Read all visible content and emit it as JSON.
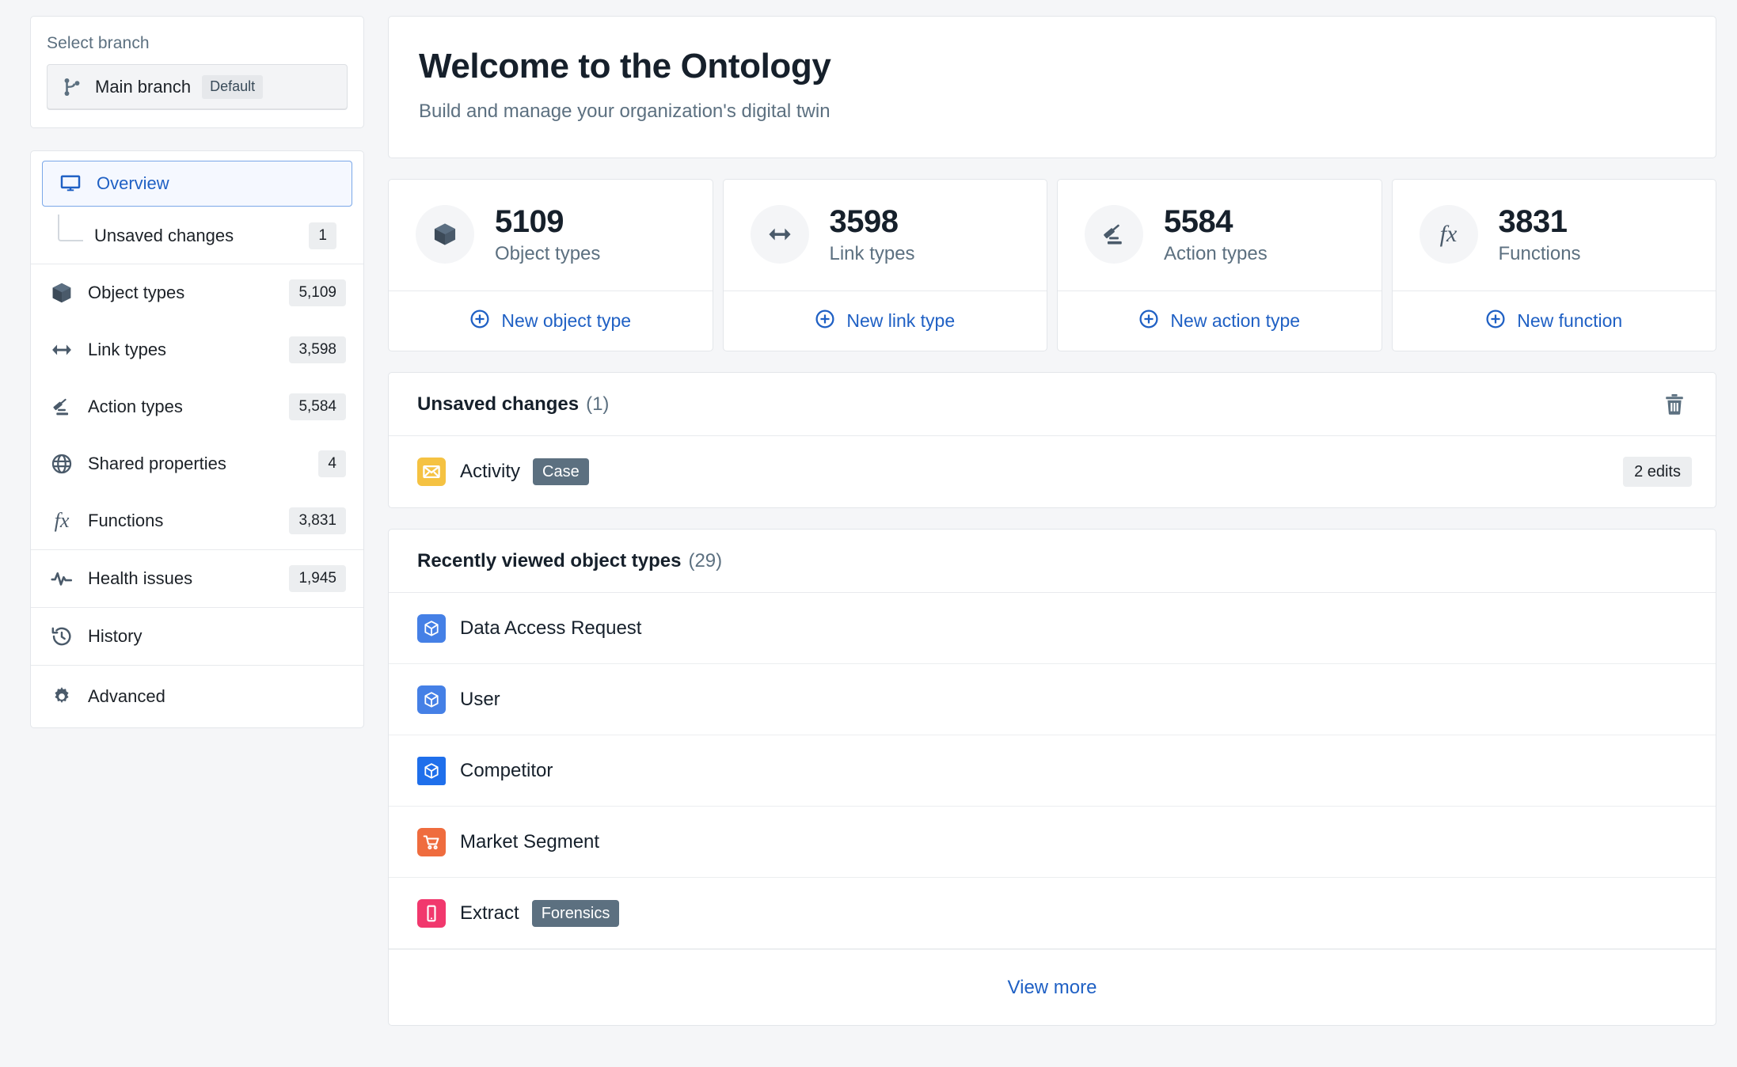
{
  "sidebar": {
    "branch": {
      "label": "Select branch",
      "name": "Main branch",
      "badge": "Default",
      "icon": "git-branch-icon"
    },
    "nav": {
      "overview": {
        "label": "Overview",
        "icon": "desktop-icon"
      },
      "unsaved": {
        "label": "Unsaved changes",
        "count": "1"
      },
      "items": [
        {
          "label": "Object types",
          "count": "5,109",
          "icon": "cube-icon"
        },
        {
          "label": "Link types",
          "count": "3,598",
          "icon": "arrows-horizontal-icon"
        },
        {
          "label": "Action types",
          "count": "5,584",
          "icon": "gavel-icon"
        },
        {
          "label": "Shared properties",
          "count": "4",
          "icon": "globe-icon"
        },
        {
          "label": "Functions",
          "count": "3,831",
          "icon": "fx-icon"
        },
        {
          "label": "Health issues",
          "count": "1,945",
          "icon": "pulse-icon"
        },
        {
          "label": "History",
          "count": "",
          "icon": "history-icon"
        },
        {
          "label": "Advanced",
          "count": "",
          "icon": "gear-icon"
        }
      ]
    }
  },
  "hero": {
    "title": "Welcome to the Ontology",
    "subtitle": "Build and manage your organization's digital twin"
  },
  "stats": [
    {
      "value": "5109",
      "label": "Object types",
      "action": "New object type",
      "icon": "cube-icon"
    },
    {
      "value": "3598",
      "label": "Link types",
      "action": "New link type",
      "icon": "arrows-horizontal-icon"
    },
    {
      "value": "5584",
      "label": "Action types",
      "action": "New action type",
      "icon": "gavel-icon"
    },
    {
      "value": "3831",
      "label": "Functions",
      "action": "New function",
      "icon": "fx-icon"
    }
  ],
  "unsaved_changes": {
    "title": "Unsaved changes",
    "count": "(1)",
    "delete_icon": "trash-icon",
    "rows": [
      {
        "label": "Activity",
        "tag": "Case",
        "edits": "2 edits",
        "icon": "envelope-icon",
        "icon_color": "#f5c242"
      }
    ]
  },
  "recently_viewed": {
    "title": "Recently viewed object types",
    "count": "(29)",
    "view_more": "View more",
    "rows": [
      {
        "label": "Data Access Request",
        "tag": "",
        "icon": "cube-icon",
        "icon_color": "#4580e6"
      },
      {
        "label": "User",
        "tag": "",
        "icon": "cube-icon",
        "icon_color": "#4580e6"
      },
      {
        "label": "Competitor",
        "tag": "",
        "icon": "cube-icon",
        "icon_color": "#1f6feb"
      },
      {
        "label": "Market Segment",
        "tag": "",
        "icon": "cart-icon",
        "icon_color": "#ef6c3e"
      },
      {
        "label": "Extract",
        "tag": "Forensics",
        "icon": "mobile-icon",
        "icon_color": "#f1386d"
      }
    ]
  },
  "colors": {
    "accent": "#1f60c4",
    "muted": "#5c7080",
    "text": "#16202b",
    "surface": "#ffffff",
    "background": "#f5f6f8",
    "border": "#e3e6ea"
  }
}
